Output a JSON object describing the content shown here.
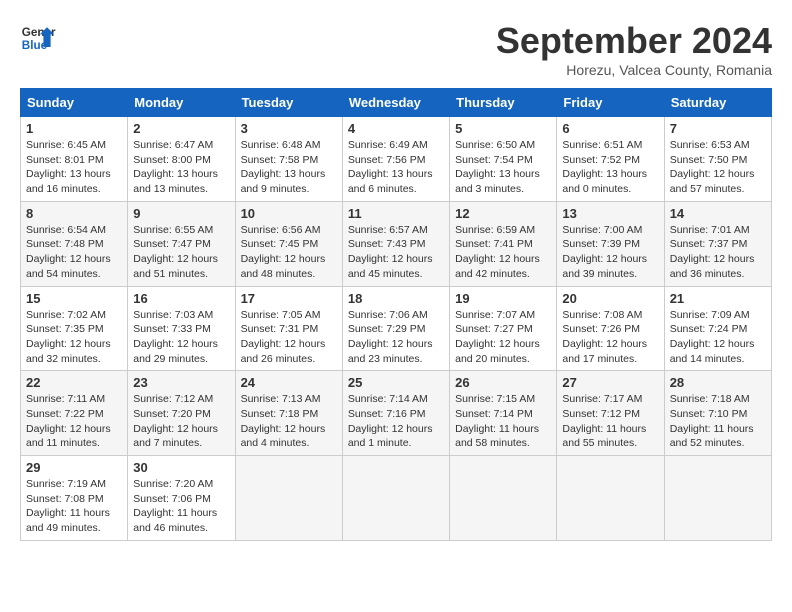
{
  "logo": {
    "line1": "General",
    "line2": "Blue"
  },
  "title": "September 2024",
  "subtitle": "Horezu, Valcea County, Romania",
  "headers": [
    "Sunday",
    "Monday",
    "Tuesday",
    "Wednesday",
    "Thursday",
    "Friday",
    "Saturday"
  ],
  "weeks": [
    [
      {
        "day": "1",
        "info": "Sunrise: 6:45 AM\nSunset: 8:01 PM\nDaylight: 13 hours\nand 16 minutes."
      },
      {
        "day": "2",
        "info": "Sunrise: 6:47 AM\nSunset: 8:00 PM\nDaylight: 13 hours\nand 13 minutes."
      },
      {
        "day": "3",
        "info": "Sunrise: 6:48 AM\nSunset: 7:58 PM\nDaylight: 13 hours\nand 9 minutes."
      },
      {
        "day": "4",
        "info": "Sunrise: 6:49 AM\nSunset: 7:56 PM\nDaylight: 13 hours\nand 6 minutes."
      },
      {
        "day": "5",
        "info": "Sunrise: 6:50 AM\nSunset: 7:54 PM\nDaylight: 13 hours\nand 3 minutes."
      },
      {
        "day": "6",
        "info": "Sunrise: 6:51 AM\nSunset: 7:52 PM\nDaylight: 13 hours\nand 0 minutes."
      },
      {
        "day": "7",
        "info": "Sunrise: 6:53 AM\nSunset: 7:50 PM\nDaylight: 12 hours\nand 57 minutes."
      }
    ],
    [
      {
        "day": "8",
        "info": "Sunrise: 6:54 AM\nSunset: 7:48 PM\nDaylight: 12 hours\nand 54 minutes."
      },
      {
        "day": "9",
        "info": "Sunrise: 6:55 AM\nSunset: 7:47 PM\nDaylight: 12 hours\nand 51 minutes."
      },
      {
        "day": "10",
        "info": "Sunrise: 6:56 AM\nSunset: 7:45 PM\nDaylight: 12 hours\nand 48 minutes."
      },
      {
        "day": "11",
        "info": "Sunrise: 6:57 AM\nSunset: 7:43 PM\nDaylight: 12 hours\nand 45 minutes."
      },
      {
        "day": "12",
        "info": "Sunrise: 6:59 AM\nSunset: 7:41 PM\nDaylight: 12 hours\nand 42 minutes."
      },
      {
        "day": "13",
        "info": "Sunrise: 7:00 AM\nSunset: 7:39 PM\nDaylight: 12 hours\nand 39 minutes."
      },
      {
        "day": "14",
        "info": "Sunrise: 7:01 AM\nSunset: 7:37 PM\nDaylight: 12 hours\nand 36 minutes."
      }
    ],
    [
      {
        "day": "15",
        "info": "Sunrise: 7:02 AM\nSunset: 7:35 PM\nDaylight: 12 hours\nand 32 minutes."
      },
      {
        "day": "16",
        "info": "Sunrise: 7:03 AM\nSunset: 7:33 PM\nDaylight: 12 hours\nand 29 minutes."
      },
      {
        "day": "17",
        "info": "Sunrise: 7:05 AM\nSunset: 7:31 PM\nDaylight: 12 hours\nand 26 minutes."
      },
      {
        "day": "18",
        "info": "Sunrise: 7:06 AM\nSunset: 7:29 PM\nDaylight: 12 hours\nand 23 minutes."
      },
      {
        "day": "19",
        "info": "Sunrise: 7:07 AM\nSunset: 7:27 PM\nDaylight: 12 hours\nand 20 minutes."
      },
      {
        "day": "20",
        "info": "Sunrise: 7:08 AM\nSunset: 7:26 PM\nDaylight: 12 hours\nand 17 minutes."
      },
      {
        "day": "21",
        "info": "Sunrise: 7:09 AM\nSunset: 7:24 PM\nDaylight: 12 hours\nand 14 minutes."
      }
    ],
    [
      {
        "day": "22",
        "info": "Sunrise: 7:11 AM\nSunset: 7:22 PM\nDaylight: 12 hours\nand 11 minutes."
      },
      {
        "day": "23",
        "info": "Sunrise: 7:12 AM\nSunset: 7:20 PM\nDaylight: 12 hours\nand 7 minutes."
      },
      {
        "day": "24",
        "info": "Sunrise: 7:13 AM\nSunset: 7:18 PM\nDaylight: 12 hours\nand 4 minutes."
      },
      {
        "day": "25",
        "info": "Sunrise: 7:14 AM\nSunset: 7:16 PM\nDaylight: 12 hours\nand 1 minute."
      },
      {
        "day": "26",
        "info": "Sunrise: 7:15 AM\nSunset: 7:14 PM\nDaylight: 11 hours\nand 58 minutes."
      },
      {
        "day": "27",
        "info": "Sunrise: 7:17 AM\nSunset: 7:12 PM\nDaylight: 11 hours\nand 55 minutes."
      },
      {
        "day": "28",
        "info": "Sunrise: 7:18 AM\nSunset: 7:10 PM\nDaylight: 11 hours\nand 52 minutes."
      }
    ],
    [
      {
        "day": "29",
        "info": "Sunrise: 7:19 AM\nSunset: 7:08 PM\nDaylight: 11 hours\nand 49 minutes."
      },
      {
        "day": "30",
        "info": "Sunrise: 7:20 AM\nSunset: 7:06 PM\nDaylight: 11 hours\nand 46 minutes."
      },
      {
        "day": "",
        "info": ""
      },
      {
        "day": "",
        "info": ""
      },
      {
        "day": "",
        "info": ""
      },
      {
        "day": "",
        "info": ""
      },
      {
        "day": "",
        "info": ""
      }
    ]
  ]
}
